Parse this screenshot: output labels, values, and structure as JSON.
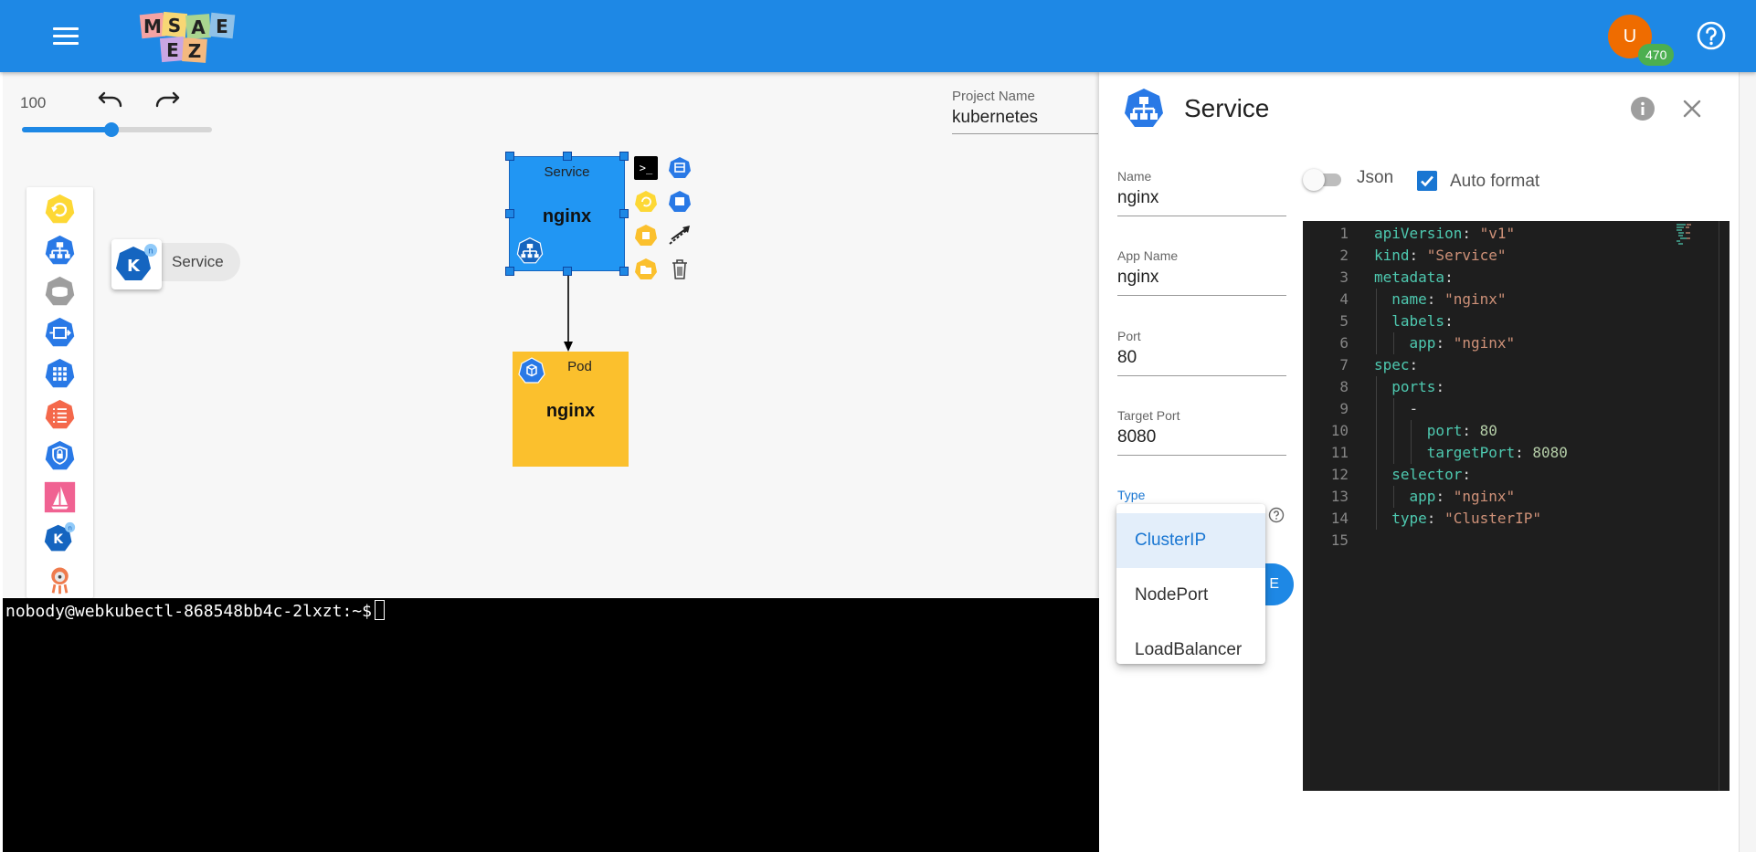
{
  "header": {
    "logo_letters": [
      "M",
      "S",
      "A",
      "E",
      "Z"
    ],
    "user_initial": "U",
    "notification_count": "470"
  },
  "canvas": {
    "zoom": "100",
    "zoom_fraction": 0.47,
    "project_label": "Project Name",
    "project_value": "kubernetes",
    "palette": [
      "cronjob-icon",
      "service-icon",
      "volume-icon",
      "deployment-icon",
      "replicaset-icon",
      "configmap-icon",
      "secret-icon",
      "istio-icon",
      "knative-icon",
      "argo-icon"
    ],
    "drag_label": "Service",
    "service_node": {
      "kind": "Service",
      "name": "nginx"
    },
    "pod_node": {
      "kind": "Pod",
      "name": "nginx"
    },
    "terminal_button": ">_"
  },
  "terminal": {
    "prompt": "nobody@webkubectl-868548bb4c-2lxzt:~$"
  },
  "panel": {
    "title": "Service",
    "fields": [
      {
        "label": "Name",
        "value": "nginx"
      },
      {
        "label": "App Name",
        "value": "nginx"
      },
      {
        "label": "Port",
        "value": "80"
      },
      {
        "label": "Target Port",
        "value": "8080"
      }
    ],
    "type_label": "Type",
    "type_options": [
      "ClusterIP",
      "NodePort",
      "LoadBalancer"
    ],
    "type_selected": "ClusterIP",
    "create_button_visible": "E",
    "json_label": "Json",
    "json_enabled": false,
    "auto_format_label": "Auto format",
    "auto_format_checked": true
  },
  "editor": {
    "lines": [
      {
        "n": "1",
        "indent": 0,
        "key": "apiVersion",
        "val": "\"v1\"",
        "vtype": "s"
      },
      {
        "n": "2",
        "indent": 0,
        "key": "kind",
        "val": "\"Service\"",
        "vtype": "s"
      },
      {
        "n": "3",
        "indent": 0,
        "key": "metadata",
        "val": "",
        "vtype": ""
      },
      {
        "n": "4",
        "indent": 1,
        "key": "name",
        "val": "\"nginx\"",
        "vtype": "s"
      },
      {
        "n": "5",
        "indent": 1,
        "key": "labels",
        "val": "",
        "vtype": ""
      },
      {
        "n": "6",
        "indent": 2,
        "key": "app",
        "val": "\"nginx\"",
        "vtype": "s"
      },
      {
        "n": "7",
        "indent": 0,
        "key": "spec",
        "val": "",
        "vtype": ""
      },
      {
        "n": "8",
        "indent": 1,
        "key": "ports",
        "val": "",
        "vtype": ""
      },
      {
        "n": "9",
        "indent": 2,
        "key": "",
        "val": "-",
        "vtype": "p"
      },
      {
        "n": "10",
        "indent": 3,
        "key": "port",
        "val": "80",
        "vtype": "n"
      },
      {
        "n": "11",
        "indent": 3,
        "key": "targetPort",
        "val": "8080",
        "vtype": "n"
      },
      {
        "n": "12",
        "indent": 1,
        "key": "selector",
        "val": "",
        "vtype": ""
      },
      {
        "n": "13",
        "indent": 2,
        "key": "app",
        "val": "\"nginx\"",
        "vtype": "s"
      },
      {
        "n": "14",
        "indent": 1,
        "key": "type",
        "val": "\"ClusterIP\"",
        "vtype": "s"
      },
      {
        "n": "15",
        "indent": 0,
        "key": "",
        "val": "",
        "vtype": ""
      }
    ]
  },
  "colors": {
    "appbar": "#1e88e5",
    "service_node": "#2196f3",
    "pod_node": "#fbc02d",
    "avatar": "#ef6c00",
    "badge": "#4caf50"
  }
}
